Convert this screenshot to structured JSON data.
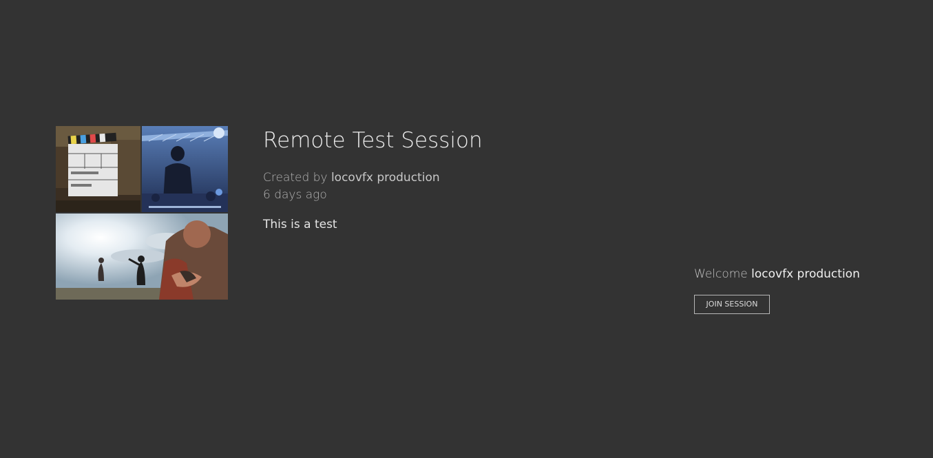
{
  "session": {
    "title": "Remote Test Session",
    "created_prefix": "Created by",
    "creator": "locovfx production",
    "created_ago": "6 days ago",
    "description": "This is a test"
  },
  "welcome": {
    "prefix": "Welcome",
    "user": "locovfx production",
    "join_button_label": "JOIN SESSION"
  },
  "thumbnails": [
    {
      "name": "clapperboard-frame"
    },
    {
      "name": "concert-stage-frame"
    },
    {
      "name": "outdoor-sunlight-frame"
    }
  ]
}
